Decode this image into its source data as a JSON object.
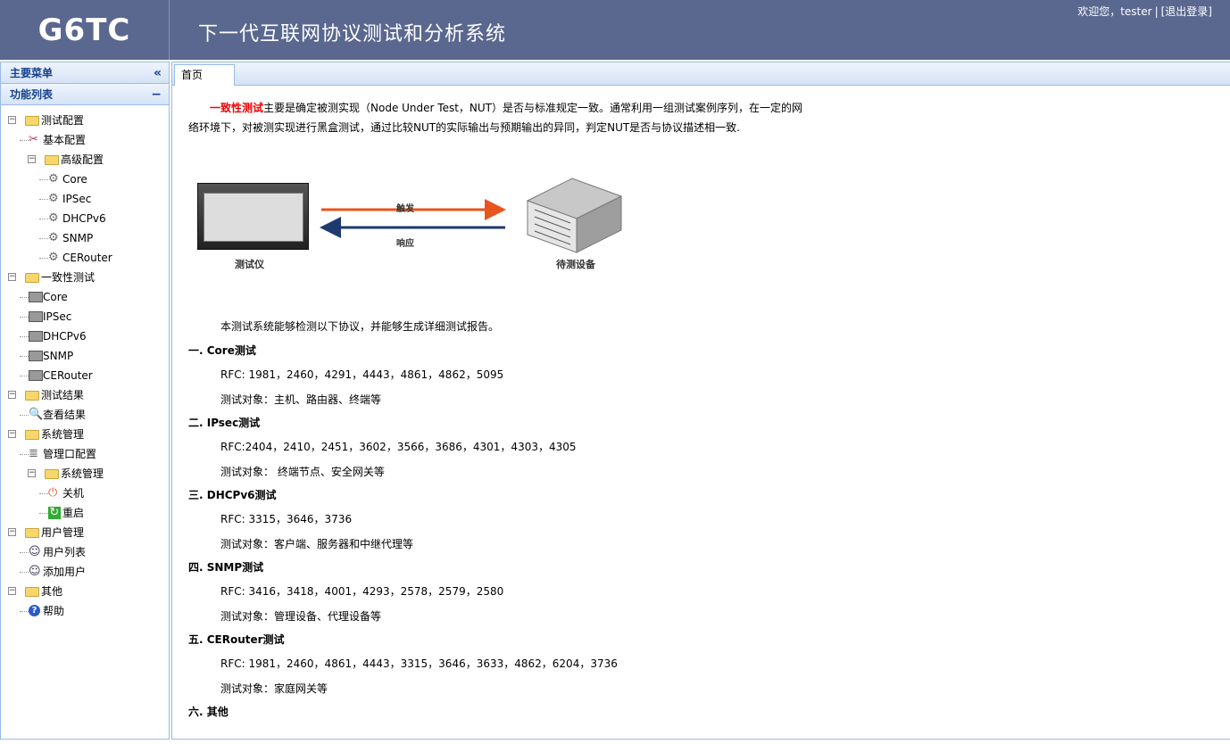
{
  "header": {
    "logo": "G6TC",
    "title": "下一代互联网协议测试和分析系统",
    "welcome": "欢迎您，tester",
    "logout": "[退出登录]"
  },
  "sidebar": {
    "main_menu_title": "主要菜单",
    "collapse_icon": "«",
    "func_list_title": "功能列表",
    "func_collapse_icon": "−",
    "tree": [
      {
        "label": "测试配置",
        "type": "folder",
        "level": 0
      },
      {
        "label": "基本配置",
        "type": "tool",
        "level": 1
      },
      {
        "label": "高级配置",
        "type": "folder",
        "level": 1
      },
      {
        "label": "Core",
        "type": "gear",
        "level": 2
      },
      {
        "label": "IPSec",
        "type": "gear",
        "level": 2
      },
      {
        "label": "DHCPv6",
        "type": "gear",
        "level": 2
      },
      {
        "label": "SNMP",
        "type": "gear",
        "level": 2
      },
      {
        "label": "CERouter",
        "type": "gear",
        "level": 2
      },
      {
        "label": "一致性测试",
        "type": "folder",
        "level": 0
      },
      {
        "label": "Core",
        "type": "server",
        "level": 1
      },
      {
        "label": "IPSec",
        "type": "server",
        "level": 1
      },
      {
        "label": "DHCPv6",
        "type": "server",
        "level": 1
      },
      {
        "label": "SNMP",
        "type": "server",
        "level": 1
      },
      {
        "label": "CERouter",
        "type": "server",
        "level": 1
      },
      {
        "label": "测试结果",
        "type": "folder",
        "level": 0
      },
      {
        "label": "查看结果",
        "type": "search",
        "level": 1
      },
      {
        "label": "系统管理",
        "type": "folder",
        "level": 0
      },
      {
        "label": "管理口配置",
        "type": "db",
        "level": 1
      },
      {
        "label": "系统管理",
        "type": "folder",
        "level": 1
      },
      {
        "label": "关机",
        "type": "power",
        "level": 2
      },
      {
        "label": "重启",
        "type": "restart",
        "level": 2
      },
      {
        "label": "用户管理",
        "type": "folder",
        "level": 0
      },
      {
        "label": "用户列表",
        "type": "user",
        "level": 1
      },
      {
        "label": "添加用户",
        "type": "useradd",
        "level": 1
      },
      {
        "label": "其他",
        "type": "folder",
        "level": 0
      },
      {
        "label": "帮助",
        "type": "help",
        "level": 1
      }
    ]
  },
  "tabs": [
    {
      "label": "首页"
    }
  ],
  "content": {
    "intro_highlight": "一致性测试",
    "intro_line1": "主要是确定被测实现（Node Under Test，NUT）是否与标准规定一致。通常利用一组测试案例序列，在一定的网",
    "intro_line2": "络环境下，对被测实现进行黑盒测试，通过比较NUT的实际输出与预期输出的异同，判定NUT是否与协议描述相一致.",
    "diagram": {
      "tester_label": "测试仪",
      "dut_label": "待测设备",
      "trigger_label": "触发",
      "response_label": "响应",
      "trigger_color": "#e8541e",
      "response_color": "#1e3a6e"
    },
    "summary": "本测试系统能够检测以下协议，并能够生成详细测试报告。",
    "sections": [
      {
        "heading": "一. Core测试",
        "rfc": "RFC: 1981，2460，4291，4443，4861，4862，5095",
        "target": "测试对象：主机、路由器、终端等"
      },
      {
        "heading": "二. IPsec测试",
        "rfc": "RFC:2404，2410，2451，3602，3566，3686，4301，4303，4305",
        "target": "测试对象： 终端节点、安全网关等"
      },
      {
        "heading": "三. DHCPv6测试",
        "rfc": "RFC: 3315，3646，3736",
        "target": "测试对象：客户端、服务器和中继代理等"
      },
      {
        "heading": "四. SNMP测试",
        "rfc": "RFC: 3416，3418，4001，4293，2578，2579，2580",
        "target": "测试对象：管理设备、代理设备等"
      },
      {
        "heading": "五. CERouter测试",
        "rfc": "RFC: 1981，2460，4861，4443，3315，3646，3633，4862，6204，3736",
        "target": "测试对象：家庭网关等"
      },
      {
        "heading": "六. 其他",
        "rfc": "",
        "target": ""
      }
    ]
  }
}
